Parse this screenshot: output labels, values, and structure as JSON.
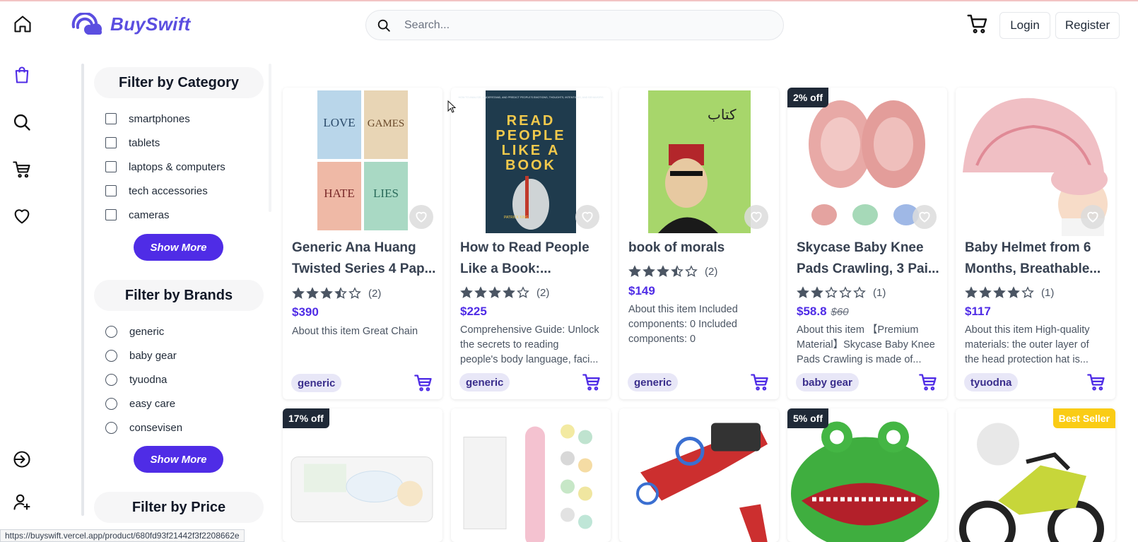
{
  "brand": {
    "name": "BuySwift",
    "color": "#5b4ee0"
  },
  "search": {
    "placeholder": "Search..."
  },
  "header": {
    "login_label": "Login",
    "register_label": "Register"
  },
  "left_rail": {
    "icons": [
      "home-icon",
      "shopping-bag-icon",
      "search-icon",
      "cart-icon",
      "heart-icon",
      "logout-icon",
      "user-plus-icon"
    ],
    "active": "shopping-bag-icon"
  },
  "filters": {
    "category": {
      "title": "Filter by Category",
      "options": [
        "smartphones",
        "tablets",
        "laptops & computers",
        "tech accessories",
        "cameras"
      ],
      "show_more": "Show More"
    },
    "brands": {
      "title": "Filter by Brands",
      "options": [
        "generic",
        "baby gear",
        "tyuodna",
        "easy care",
        "consevisen"
      ],
      "show_more": "Show More"
    },
    "price": {
      "title": "Filter by Price"
    }
  },
  "accent_color": "#4f2ce6",
  "products": [
    {
      "title_line1": "Generic Ana Huang",
      "title_line2": "Twisted Series 4 Pap...",
      "rating": 3.5,
      "reviews": "(2)",
      "price": "$390",
      "desc_lines": [
        "About this item Great Chain"
      ],
      "tag": "generic"
    },
    {
      "title_line1": "How to Read People",
      "title_line2": "Like a Book:...",
      "rating": 4,
      "reviews": "(2)",
      "price": "$225",
      "desc_lines": [
        "Comprehensive Guide: Unlock",
        "the secrets to reading",
        "people's body language, faci..."
      ],
      "tag": "generic",
      "cover": {
        "top": "HOW TO ANALYZE, UNDERSTAND, AND PREDICT PEOPLE'S EMOTIONS, THOUGHTS, INTENTIONS, AND BEHAVIORS",
        "words": [
          "READ",
          "PEOPLE",
          "LIKE A",
          "BOOK"
        ],
        "author": "PATRICK KING"
      }
    },
    {
      "title_line1": "book of morals",
      "rating": 3.5,
      "reviews": "(2)",
      "price": "$149",
      "desc_lines": [
        "About this item Included",
        "components: 0 Included",
        "components: 0"
      ],
      "tag": "generic"
    },
    {
      "title_line1": "Skycase Baby Knee",
      "title_line2": "Pads Crawling, 3 Pai...",
      "rating": 2,
      "reviews": "(1)",
      "price": "$58.8",
      "old_price": "$60",
      "badge": "2% off",
      "desc_lines": [
        "About this item 【Premium",
        "Material】Skycase Baby Knee",
        "Pads Crawling is made of..."
      ],
      "tag": "baby gear"
    },
    {
      "title_line1": "Baby Helmet from 6",
      "title_line2": "Months, Breathable...",
      "rating": 4,
      "reviews": "(1)",
      "price": "$117",
      "desc_lines": [
        "About this item High-quality",
        "materials: the outer layer of",
        "the head protection hat is..."
      ],
      "tag": "tyuodna"
    }
  ],
  "row2_badges": {
    "card1": "17% off",
    "card4": "5% off",
    "card5": "Best Seller"
  },
  "status_url": "https://buyswift.vercel.app/product/680fd93f21442f3f2208662e"
}
